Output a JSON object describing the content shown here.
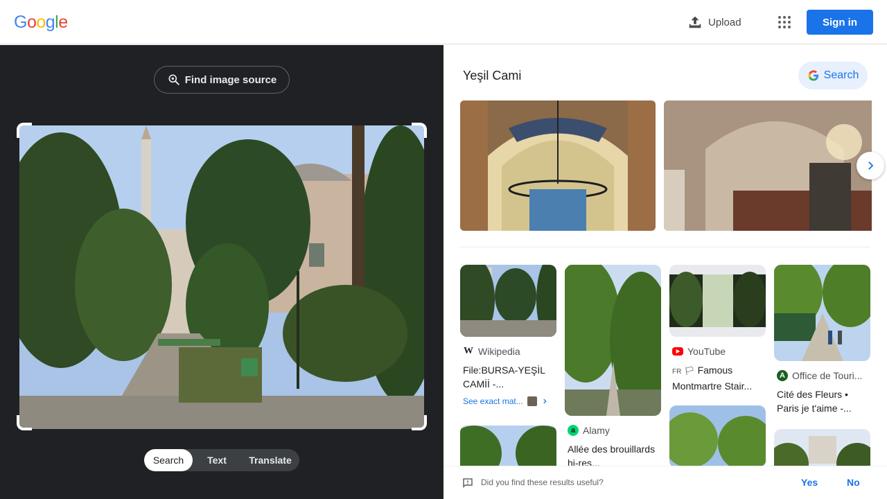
{
  "header": {
    "logo_letters": [
      "G",
      "o",
      "o",
      "g",
      "l",
      "e"
    ],
    "upload_label": "Upload",
    "sign_in_label": "Sign in"
  },
  "left": {
    "find_source_label": "Find image source",
    "tabs": [
      "Search",
      "Text",
      "Translate"
    ],
    "active_tab": "Search"
  },
  "results": {
    "title": "Yeşil Cami",
    "search_button_label": "Search",
    "cards": [
      {
        "source": "Wikipedia",
        "title": "File:BURSA-YEŞİL CAMİİ -...",
        "exact_match": "See exact mat..."
      },
      {
        "source": "Alamy",
        "title": "Allée des brouillards hi-res..."
      },
      {
        "source": "YouTube",
        "lang": "FR",
        "title": "Famous Montmartre Stair..."
      },
      {
        "source": "Office de Touri...",
        "title": "Cité des Fleurs • Paris je t'aime -..."
      }
    ]
  },
  "feedback": {
    "question": "Did you find these results useful?",
    "yes": "Yes",
    "no": "No"
  },
  "colors": {
    "accent": "#1a73e8",
    "dark_panel": "#202124"
  }
}
